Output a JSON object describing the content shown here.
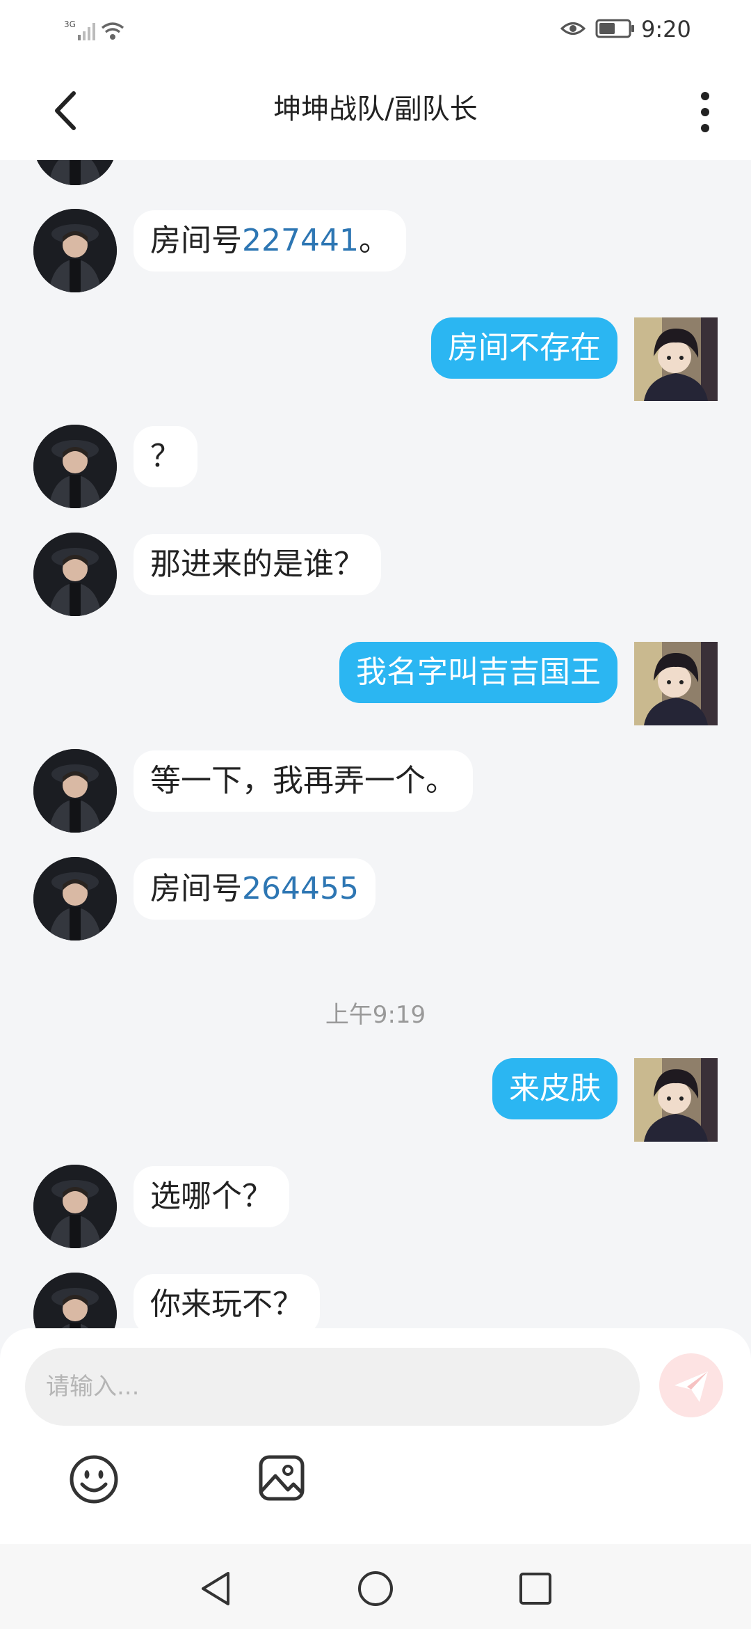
{
  "status_bar": {
    "network": "3G",
    "time": "9:20"
  },
  "header": {
    "title": "坤坤战队/副队长"
  },
  "messages": [
    {
      "prefix": "房间号",
      "number": "227441",
      "suffix": "。"
    },
    {
      "text": "房间不存在"
    },
    {
      "text": "？"
    },
    {
      "text": "那进来的是谁？"
    },
    {
      "text": "我名字叫吉吉国王"
    },
    {
      "text": "等一下，我再弄一个。"
    },
    {
      "prefix": "房间号",
      "number": "264455",
      "suffix": ""
    },
    {
      "text": "来皮肤"
    },
    {
      "text": "选哪个？"
    },
    {
      "text": "你来玩不？"
    }
  ],
  "timestamp": "上午9:19",
  "input": {
    "placeholder": "请输入..."
  },
  "colors": {
    "outgoing_bubble": "#2bb6f2",
    "link_number": "#2d76b3",
    "send_button": "#fde3e3"
  }
}
